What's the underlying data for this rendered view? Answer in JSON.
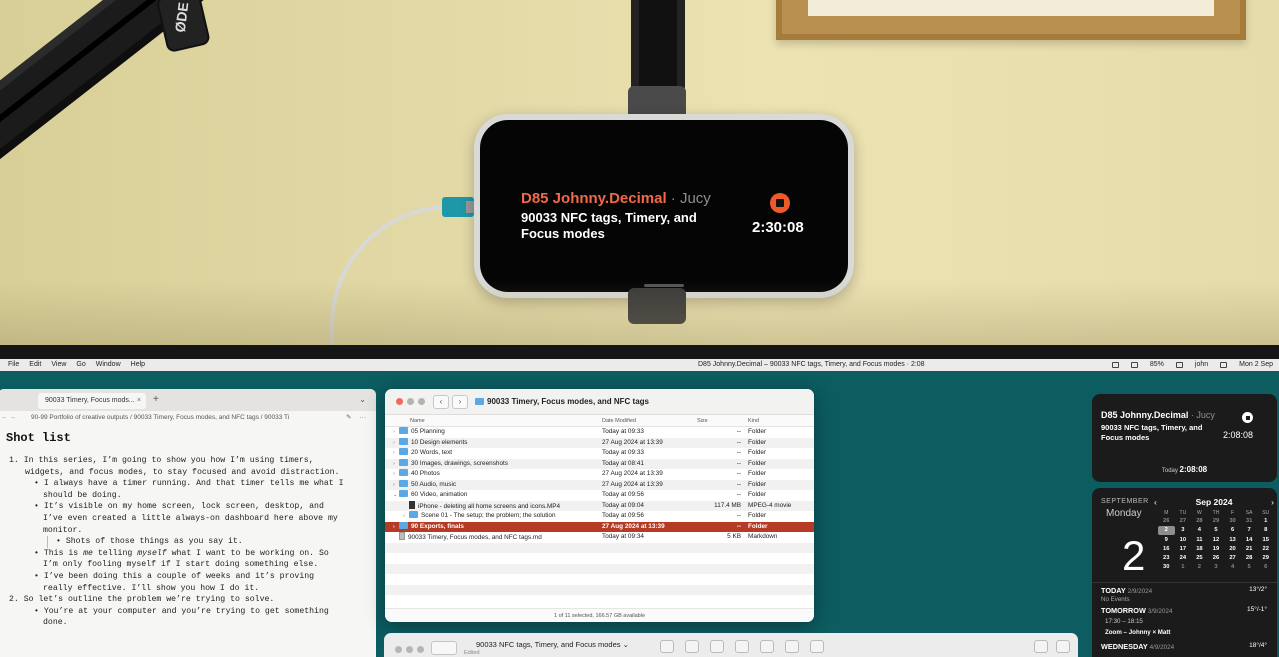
{
  "photo": {
    "arm_tag": "ØDE",
    "phone": {
      "area": "D85 Johnny.Decimal",
      "separator": "·",
      "owner": "Jucy",
      "task": "90033 NFC tags, Timery, and Focus modes",
      "timer": "2:30:08"
    }
  },
  "menubar": {
    "items": [
      "File",
      "Edit",
      "View",
      "Go",
      "Window",
      "Help"
    ],
    "status_text": "D85 Johnny.Decimal – 90033 NFC tags, Timery, and Focus modes · 2:08",
    "battery": "85%",
    "user": "john",
    "date": "Mon 2 Sep"
  },
  "editor": {
    "tab_title": "90033 Timery, Focus mods...",
    "tab_close": "×",
    "tab_add": "+",
    "tab_menu": "⌄",
    "nav_back": "←",
    "nav_forward": "→",
    "breadcrumb": "90-99 Portfolio of creative outputs / 90033 Timery, Focus modes, and NFC tags / 90033 Ti",
    "tool_edit": "✎",
    "tool_more": "···",
    "heading": "Shot list",
    "lines": [
      "1. In this series, I’m going to show you how I’m using timers,",
      "widgets, and focus modes, to stay focused and avoid distraction.",
      "• I always have a timer running. And that timer tells me what I",
      "should be doing.",
      "• It’s visible on my home screen, lock screen, desktop, and",
      "I’ve even created a little always-on dashboard here above my",
      "monitor.",
      "• Shots of those things as you say it.",
      "• This is ",
      "me",
      " telling ",
      "myself",
      " what I want to be working on. So",
      "I’m only fooling myself if I start doing something else.",
      "• I’ve been doing this a couple of weeks and it’s proving",
      "really effective. I’ll show you how I do it.",
      "2. So let’s outline the problem we’re trying to solve.",
      "• You’re at your computer and you’re trying to get something",
      "done."
    ]
  },
  "finder": {
    "title": "90033 Timery, Focus modes, and NFC tags",
    "nav_back": "‹",
    "nav_forward": "›",
    "columns": [
      "Name",
      "Date Modified",
      "Size",
      "Kind"
    ],
    "rows": [
      {
        "name": "05 Planning",
        "date": "Today at 09:33",
        "size": "--",
        "kind": "Folder",
        "type": "folder",
        "disc": "›"
      },
      {
        "name": "10 Design elements",
        "date": "27 Aug 2024 at 13:39",
        "size": "--",
        "kind": "Folder",
        "type": "folder",
        "disc": "›"
      },
      {
        "name": "20 Words, text",
        "date": "Today at 09:33",
        "size": "--",
        "kind": "Folder",
        "type": "folder",
        "disc": "›"
      },
      {
        "name": "30 Images, drawings, screenshots",
        "date": "Today at 08:41",
        "size": "--",
        "kind": "Folder",
        "type": "folder",
        "disc": "›"
      },
      {
        "name": "40 Photos",
        "date": "27 Aug 2024 at 13:39",
        "size": "--",
        "kind": "Folder",
        "type": "folder",
        "disc": "›"
      },
      {
        "name": "50 Audio, music",
        "date": "27 Aug 2024 at 13:39",
        "size": "--",
        "kind": "Folder",
        "type": "folder",
        "disc": "›"
      },
      {
        "name": "60 Video, animation",
        "date": "Today at 09:56",
        "size": "--",
        "kind": "Folder",
        "type": "folder",
        "disc": "⌄"
      },
      {
        "name": "iPhone - deleting all home screens and icons.MP4",
        "date": "Today at 09:04",
        "size": "117.4 MB",
        "kind": "MPEG-4 movie",
        "type": "movie",
        "disc": ""
      },
      {
        "name": "Scene 01 - The setup; the problem; the solution",
        "date": "Today at 09:56",
        "size": "--",
        "kind": "Folder",
        "type": "folder",
        "disc": "›"
      },
      {
        "name": "90 Exports, finals",
        "date": "27 Aug 2024 at 13:39",
        "size": "--",
        "kind": "Folder",
        "type": "folder",
        "disc": "›"
      },
      {
        "name": "90033 Timery, Focus modes, and NFC tags.md",
        "date": "Today at 09:34",
        "size": "5 KB",
        "kind": "Markdown",
        "type": "file",
        "disc": ""
      }
    ],
    "status": "1 of 11 selected, 166.57 GB available"
  },
  "window2": {
    "title": "90033 NFC tags, Timery, and Focus modes",
    "title_menu": "⌄",
    "subtitle": "Edited"
  },
  "timer_widget": {
    "area": "D85 Johnny.Decimal",
    "separator": "·",
    "owner": "Jucy",
    "task": "90033 NFC tags, Timery, and Focus modes",
    "elapsed": "2:08:08",
    "today_label": "Today",
    "today_total": "2:08:08"
  },
  "calendar_widget": {
    "month_caption": "SEPTEMBER",
    "weekday": "Monday",
    "day": "2",
    "prev": "‹",
    "next": "›",
    "grid_title": "Sep 2024",
    "weekday_heads": [
      "M",
      "TU",
      "W",
      "TH",
      "F",
      "SA",
      "SU"
    ],
    "weeks": [
      [
        "26",
        "27",
        "28",
        "29",
        "30",
        "31",
        "1"
      ],
      [
        "2",
        "3",
        "4",
        "5",
        "6",
        "7",
        "8"
      ],
      [
        "9",
        "10",
        "11",
        "12",
        "13",
        "14",
        "15"
      ],
      [
        "16",
        "17",
        "18",
        "19",
        "20",
        "21",
        "22"
      ],
      [
        "23",
        "24",
        "25",
        "26",
        "27",
        "28",
        "29"
      ],
      [
        "30",
        "1",
        "2",
        "3",
        "4",
        "5",
        "6"
      ]
    ],
    "today_row": {
      "label": "TODAY",
      "date": "2/9/2024",
      "weather": "13°/2°"
    },
    "no_events": "No Events",
    "tomorrow_row": {
      "label": "TOMORROW",
      "date": "3/9/2024",
      "weather": "15°/-1°"
    },
    "event_time": "17:30 – 18:15",
    "event_title": "Zoom – Johnny × Matt",
    "wednesday_row": {
      "label": "WEDNESDAY",
      "date": "4/9/2024",
      "weather": "18°/4°"
    }
  },
  "colors": {
    "desktop": "#0c5c60",
    "selection": "#b63a24",
    "area_accent": "#ef6a4a",
    "stop_button": "#ef5a2a"
  }
}
